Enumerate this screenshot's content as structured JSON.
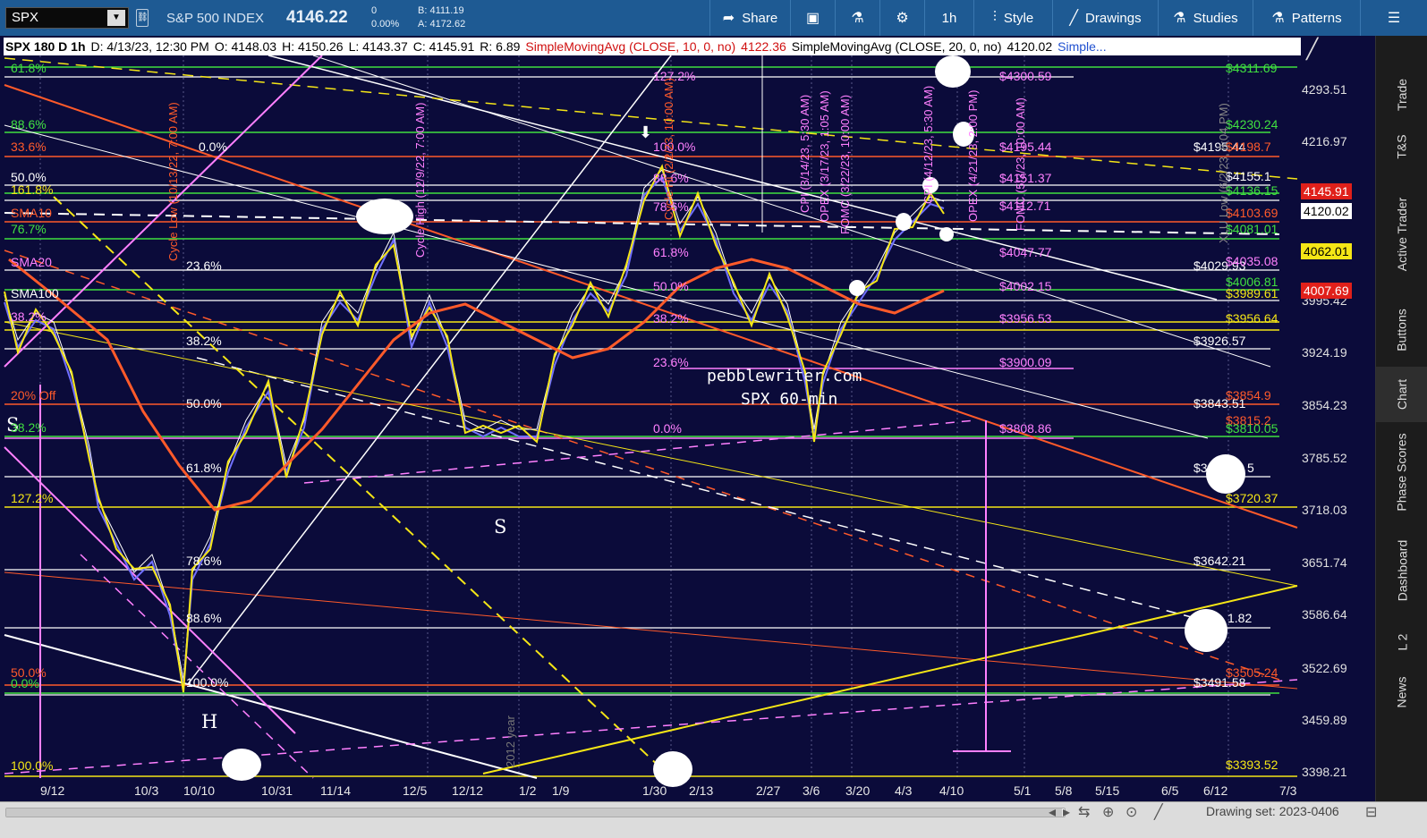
{
  "toolbar": {
    "symbol": "SPX",
    "name": "S&P 500 INDEX",
    "price": "4146.22",
    "change": "0",
    "change_pct": "0.00%",
    "bid": "B: 4111.19",
    "ask": "A: 4172.62",
    "share": "Share",
    "timeframe": "1h",
    "style": "Style",
    "drawings": "Drawings",
    "studies": "Studies",
    "patterns": "Patterns"
  },
  "infobar": {
    "symbol": "SPX 180 D 1h",
    "date": "D: 4/13/23, 12:30 PM",
    "open": "O: 4148.03",
    "high": "H: 4150.26",
    "low": "L: 4143.37",
    "close": "C: 4145.91",
    "range": "R: 6.89",
    "sma10": "SimpleMovingAvg (CLOSE, 10, 0, no)",
    "sma10_val": "4122.36",
    "sma20": "SimpleMovingAvg (CLOSE, 20, 0, no)",
    "sma20_val": "4120.02",
    "more": "Simple..."
  },
  "price_axis": [
    "4293.51",
    "4216.97",
    "4143.8",
    "4062.01",
    "3995.42",
    "3924.19",
    "3854.23",
    "3785.52",
    "3718.03",
    "3651.74",
    "3586.64",
    "3522.69",
    "3459.89",
    "3398.21"
  ],
  "price_tags": [
    {
      "text": "4145.91",
      "bg": "#e0201a",
      "fg": "#ffffff"
    },
    {
      "text": "4120.02",
      "bg": "#ffffff",
      "fg": "#000000"
    },
    {
      "text": "4062.01",
      "bg": "#f5e616",
      "fg": "#000000"
    },
    {
      "text": "4007.69",
      "bg": "#e0201a",
      "fg": "#ffffff"
    }
  ],
  "time_axis": [
    "9/12",
    "10/3",
    "10/10",
    "10/31",
    "11/14",
    "12/5",
    "12/12",
    "1/2",
    "1/9",
    "1/30",
    "2/13",
    "2/27",
    "3/6",
    "3/20",
    "4/3",
    "4/10",
    "5/1",
    "5/8",
    "5/15",
    "6/5",
    "6/12",
    "7/3"
  ],
  "levels_left": [
    {
      "text": "61.8%",
      "color": "#40e040"
    },
    {
      "text": "88.6%",
      "color": "#40e040"
    },
    {
      "text": "33.6%",
      "color": "#ff5a2a"
    },
    {
      "text": "50.0%",
      "color": "#ffffff"
    },
    {
      "text": "161.8%",
      "color": "#f5e616"
    },
    {
      "text": "SMA10",
      "color": "#ff5a2a"
    },
    {
      "text": "76.7%",
      "color": "#40e040"
    },
    {
      "text": "SMA20",
      "color": "#ff80ff"
    },
    {
      "text": "SMA100",
      "color": "#ffffff"
    },
    {
      "text": "38.2%",
      "color": "#ff80ff"
    },
    {
      "text": "20% Off",
      "color": "#ff5a2a"
    },
    {
      "text": "S",
      "color": "#ffffff"
    },
    {
      "text": "38.2%",
      "color": "#40e040"
    },
    {
      "text": "127.2%",
      "color": "#f5e616"
    },
    {
      "text": "50.0%",
      "color": "#ff5a2a"
    },
    {
      "text": "0.0%",
      "color": "#40e040"
    },
    {
      "text": "100.0%",
      "color": "#f5e616"
    },
    {
      "text": "H",
      "color": "#ffffff"
    }
  ],
  "fib_mid": [
    {
      "text": "0.0%",
      "color": "#ffffff"
    },
    {
      "text": "23.6%",
      "color": "#ffffff"
    },
    {
      "text": "38.2%",
      "color": "#ffffff"
    },
    {
      "text": "50.0%",
      "color": "#ffffff"
    },
    {
      "text": "61.8%",
      "color": "#ffffff"
    },
    {
      "text": "78.6%",
      "color": "#ffffff"
    },
    {
      "text": "88.6%",
      "color": "#ffffff"
    },
    {
      "text": "100.0%",
      "color": "#ffffff"
    }
  ],
  "fib_right": [
    {
      "text": "127.2%",
      "color": "#ff80ff"
    },
    {
      "text": "100.0%",
      "color": "#ff80ff"
    },
    {
      "text": "88.6%",
      "color": "#ff80ff"
    },
    {
      "text": "78.6%",
      "color": "#ff80ff"
    },
    {
      "text": "61.8%",
      "color": "#ff80ff"
    },
    {
      "text": "50.0%",
      "color": "#ff80ff"
    },
    {
      "text": "38.2%",
      "color": "#ff80ff"
    },
    {
      "text": "23.6%",
      "color": "#ff80ff"
    },
    {
      "text": "0.0%",
      "color": "#ff80ff"
    }
  ],
  "magenta_levels": [
    "$4300.59",
    "$4195.44",
    "$4151.37",
    "$4112.71",
    "$4047.77",
    "$4002.15",
    "$3956.53",
    "$3900.09",
    "$3808.86"
  ],
  "white_levels": [
    "$4195.44",
    "$4029.93",
    "$3926.57",
    "$3843.51",
    "$3642.21",
    "$3491.58"
  ],
  "right_levels": [
    {
      "text": "$4311.69",
      "color": "#40e040"
    },
    {
      "text": "$4230.24",
      "color": "#40e040"
    },
    {
      "text": "$4198.7",
      "color": "#ff5a2a"
    },
    {
      "text": "$4155.1",
      "color": "#ffffff"
    },
    {
      "text": "$4136.15",
      "color": "#40e040"
    },
    {
      "text": "$4103.69",
      "color": "#ff5a2a"
    },
    {
      "text": "$4081.01",
      "color": "#40e040"
    },
    {
      "text": "$4035.08",
      "color": "#ff80ff"
    },
    {
      "text": "$4006.81",
      "color": "#40e040"
    },
    {
      "text": "$3989.61",
      "color": "#f5e616"
    },
    {
      "text": "$3956.64",
      "color": "#f5e616"
    },
    {
      "text": "$3854.9",
      "color": "#ff5a2a"
    },
    {
      "text": "$3815.2",
      "color": "#ff5a2a"
    },
    {
      "text": "$3810.05",
      "color": "#40e040"
    },
    {
      "text": "$3720.37",
      "color": "#f5e616"
    },
    {
      "text": "$3505.24",
      "color": "#ff5a2a"
    },
    {
      "text": "$3393.52",
      "color": "#f5e616"
    }
  ],
  "partial_labels": [
    "$3",
    "5",
    "1.82"
  ],
  "vertical_labels": [
    {
      "text": "Cycle Low (10/13/22, 7:00 AM)",
      "color": "#ff5a2a"
    },
    {
      "text": "Cycle High (12/9/22, 7:00 AM)",
      "color": "#ff80ff"
    },
    {
      "text": "Cycle Hi (2/2/23, 10:00 AM)",
      "color": "#ff5a2a"
    },
    {
      "text": "CPI (3/14/23, 5:30 AM)",
      "color": "#ff80ff"
    },
    {
      "text": "OPEX (3/17/23, 1:05 AM)",
      "color": "#ff80ff"
    },
    {
      "text": "FOMC (3/22/23, 10:00 AM)",
      "color": "#ff80ff"
    },
    {
      "text": "CPI (4/12/23, 5:30 AM)",
      "color": "#ff80ff"
    },
    {
      "text": "OPEX (4/21/23, 2:00 PM)",
      "color": "#ff80ff"
    },
    {
      "text": "FOMC (5/3/23, 10:00 AM)",
      "color": "#ff80ff"
    },
    {
      "text": "XLU Low (6/2/23, 8:04 PM)",
      "color": "#888888"
    },
    {
      "text": "2012 year",
      "color": "#777777"
    }
  ],
  "watermark": {
    "line1": "pebblewriter.com",
    "line2": "SPX 60-min"
  },
  "letters": {
    "s_mid": "S"
  },
  "sidebar": [
    "Trade",
    "T&S",
    "Active Trader",
    "Buttons",
    "Chart",
    "Phase Scores",
    "Dashboard",
    "L 2",
    "News"
  ],
  "bottombar": {
    "drawing_set": "Drawing set: 2023-0406"
  },
  "colors": {
    "toolbar": "#1e5a93",
    "background": "#0b0b3a",
    "orange": "#ff5a2a",
    "yellow": "#f5e616",
    "magenta": "#ff80ff",
    "green": "#40e040"
  }
}
